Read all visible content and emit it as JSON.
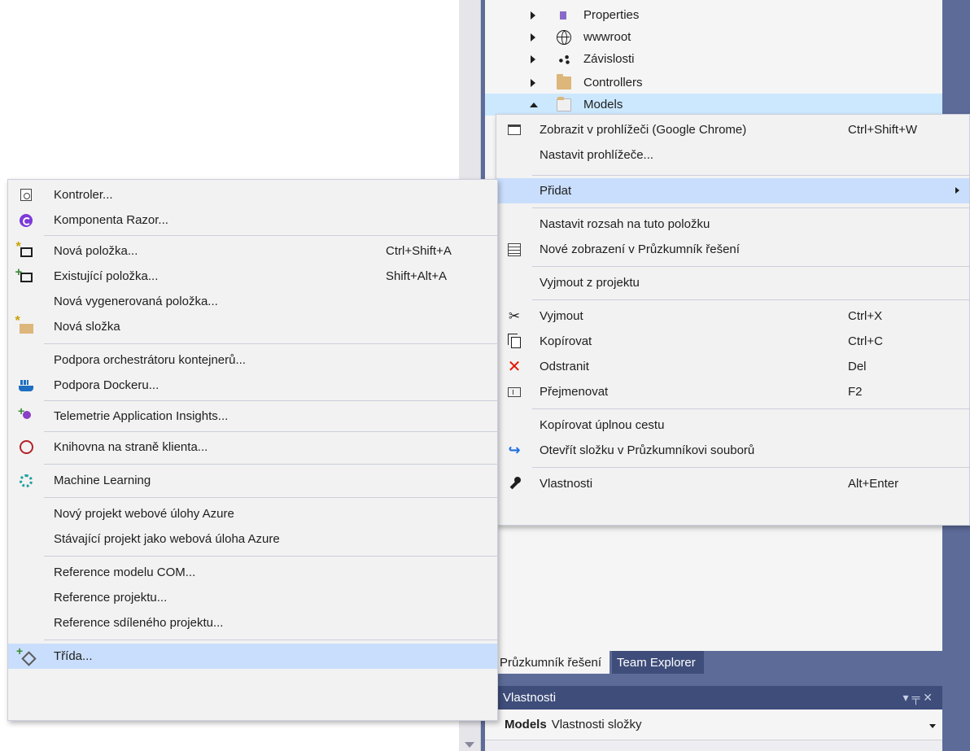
{
  "solution_tree": {
    "items": [
      {
        "label": "Properties",
        "icon": "properties-icon",
        "expanded": false
      },
      {
        "label": "wwwroot",
        "icon": "globe-icon",
        "expanded": false
      },
      {
        "label": "Závislosti",
        "icon": "dependencies-icon",
        "expanded": false
      },
      {
        "label": "Controllers",
        "icon": "folder-icon",
        "expanded": false
      },
      {
        "label": "Models",
        "icon": "folder-open-icon",
        "expanded": true,
        "selected": true
      }
    ]
  },
  "main_menu": {
    "items": [
      {
        "label": "Zobrazit v prohlížeči (Google Chrome)",
        "shortcut": "Ctrl+Shift+W",
        "icon": "browser-icon"
      },
      {
        "label": "Nastavit prohlížeče...",
        "shortcut": "",
        "icon": ""
      },
      {
        "label": "Přidat",
        "shortcut": "",
        "icon": "",
        "submenu": true,
        "highlighted": true
      },
      {
        "label": "Nastavit rozsah na tuto položku",
        "shortcut": "",
        "icon": ""
      },
      {
        "label": "Nové zobrazení v Průzkumník řešení",
        "shortcut": "",
        "icon": "new-view-icon"
      },
      {
        "label": "Vyjmout z projektu",
        "shortcut": "",
        "icon": ""
      },
      {
        "label": "Vyjmout",
        "shortcut": "Ctrl+X",
        "icon": "scissors-icon"
      },
      {
        "label": "Kopírovat",
        "shortcut": "Ctrl+C",
        "icon": "copy-icon"
      },
      {
        "label": "Odstranit",
        "shortcut": "Del",
        "icon": "delete-icon"
      },
      {
        "label": "Přejmenovat",
        "shortcut": "F2",
        "icon": "rename-icon"
      },
      {
        "label": "Kopírovat úplnou cestu",
        "shortcut": "",
        "icon": ""
      },
      {
        "label": "Otevřít složku v Průzkumníkovi souborů",
        "shortcut": "",
        "icon": "open-folder-icon"
      },
      {
        "label": "Vlastnosti",
        "shortcut": "Alt+Enter",
        "icon": "wrench-icon"
      }
    ]
  },
  "add_menu": {
    "items": [
      {
        "label": "Kontroler...",
        "shortcut": "",
        "icon": "controller-icon"
      },
      {
        "label": "Komponenta Razor...",
        "shortcut": "",
        "icon": "razor-icon"
      },
      {
        "label": "Nová položka...",
        "shortcut": "Ctrl+Shift+A",
        "icon": "new-item-icon"
      },
      {
        "label": "Existující položka...",
        "shortcut": "Shift+Alt+A",
        "icon": "existing-item-icon"
      },
      {
        "label": "Nová vygenerovaná položka...",
        "shortcut": "",
        "icon": ""
      },
      {
        "label": "Nová složka",
        "shortcut": "",
        "icon": "new-folder-icon"
      },
      {
        "label": "Podpora orchestrátoru kontejnerů...",
        "shortcut": "",
        "icon": ""
      },
      {
        "label": "Podpora Dockeru...",
        "shortcut": "",
        "icon": "docker-icon"
      },
      {
        "label": "Telemetrie Application Insights...",
        "shortcut": "",
        "icon": "insights-icon"
      },
      {
        "label": "Knihovna na straně klienta...",
        "shortcut": "",
        "icon": "library-icon"
      },
      {
        "label": "Machine Learning",
        "shortcut": "",
        "icon": "ml-icon"
      },
      {
        "label": "Nový projekt webové úlohy Azure",
        "shortcut": "",
        "icon": ""
      },
      {
        "label": "Stávající projekt jako webová úloha Azure",
        "shortcut": "",
        "icon": ""
      },
      {
        "label": "Reference modelu COM...",
        "shortcut": "",
        "icon": ""
      },
      {
        "label": "Reference projektu...",
        "shortcut": "",
        "icon": ""
      },
      {
        "label": "Reference sdíleného projektu...",
        "shortcut": "",
        "icon": ""
      },
      {
        "label": "Třída...",
        "shortcut": "",
        "icon": "class-icon",
        "highlighted": true
      }
    ]
  },
  "bottom_tabs": {
    "solution_explorer": "Průzkumník řešení",
    "team_explorer": "Team Explorer"
  },
  "properties_panel": {
    "title": "Vlastnosti",
    "object_name": "Models",
    "object_type": "Vlastnosti složky",
    "pin_glyph": "▾ ╤ ✕"
  },
  "colors": {
    "menu_bg": "#f2f2f2",
    "menu_highlight": "#c9defc",
    "ide_dark": "#5d6b99",
    "tab_dark": "#3e4d7a",
    "delete_red": "#e51400"
  }
}
